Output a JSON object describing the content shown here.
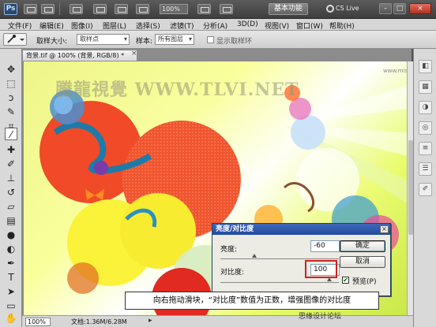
{
  "titlebar": {
    "logo": "Ps",
    "zoom": "100%",
    "workspace": "基本功能",
    "cslive": "CS Live",
    "minimize": "–",
    "restore": "□",
    "close": "×"
  },
  "menu": [
    "文件(F)",
    "编辑(E)",
    "图像(I)",
    "图层(L)",
    "选择(S)",
    "滤镜(T)",
    "分析(A)",
    "3D(D)",
    "视图(V)",
    "窗口(W)",
    "帮助(H)"
  ],
  "options": {
    "sample_size_label": "取样大小:",
    "sample_size_value": "取样点",
    "sample_label": "样本:",
    "sample_value": "所有图层",
    "show_ring_label": "显示取样环"
  },
  "document": {
    "tab_title": "背景.tif @ 100% (背景, RGB/8) *",
    "tab_close": "×",
    "watermark": "騰龍視覺 WWW.TLVI.NET",
    "credit": "思缘设计论坛",
    "credit_small": "www.missyuan.com"
  },
  "status": {
    "zoom": "100%",
    "doc_info": "文档:1.36M/6.28M",
    "arrow": "▸"
  },
  "dialog": {
    "title": "亮度/对比度",
    "close": "×",
    "brightness_label": "亮度:",
    "brightness_value": "-60",
    "contrast_label": "对比度:",
    "contrast_value": "100",
    "ok_label": "确定",
    "cancel_label": "取消",
    "preview_label": "预览(P)",
    "preview_checked": true
  },
  "caption": "向右拖动滑块，“对比度”数值为正数，增强图像的对比度",
  "colors": {
    "title_bar": "#474747",
    "dialog_title": "#2f58ac",
    "highlight": "#d02020",
    "canvas_red": "#f04a28",
    "canvas_yellow": "#fbf23a"
  }
}
